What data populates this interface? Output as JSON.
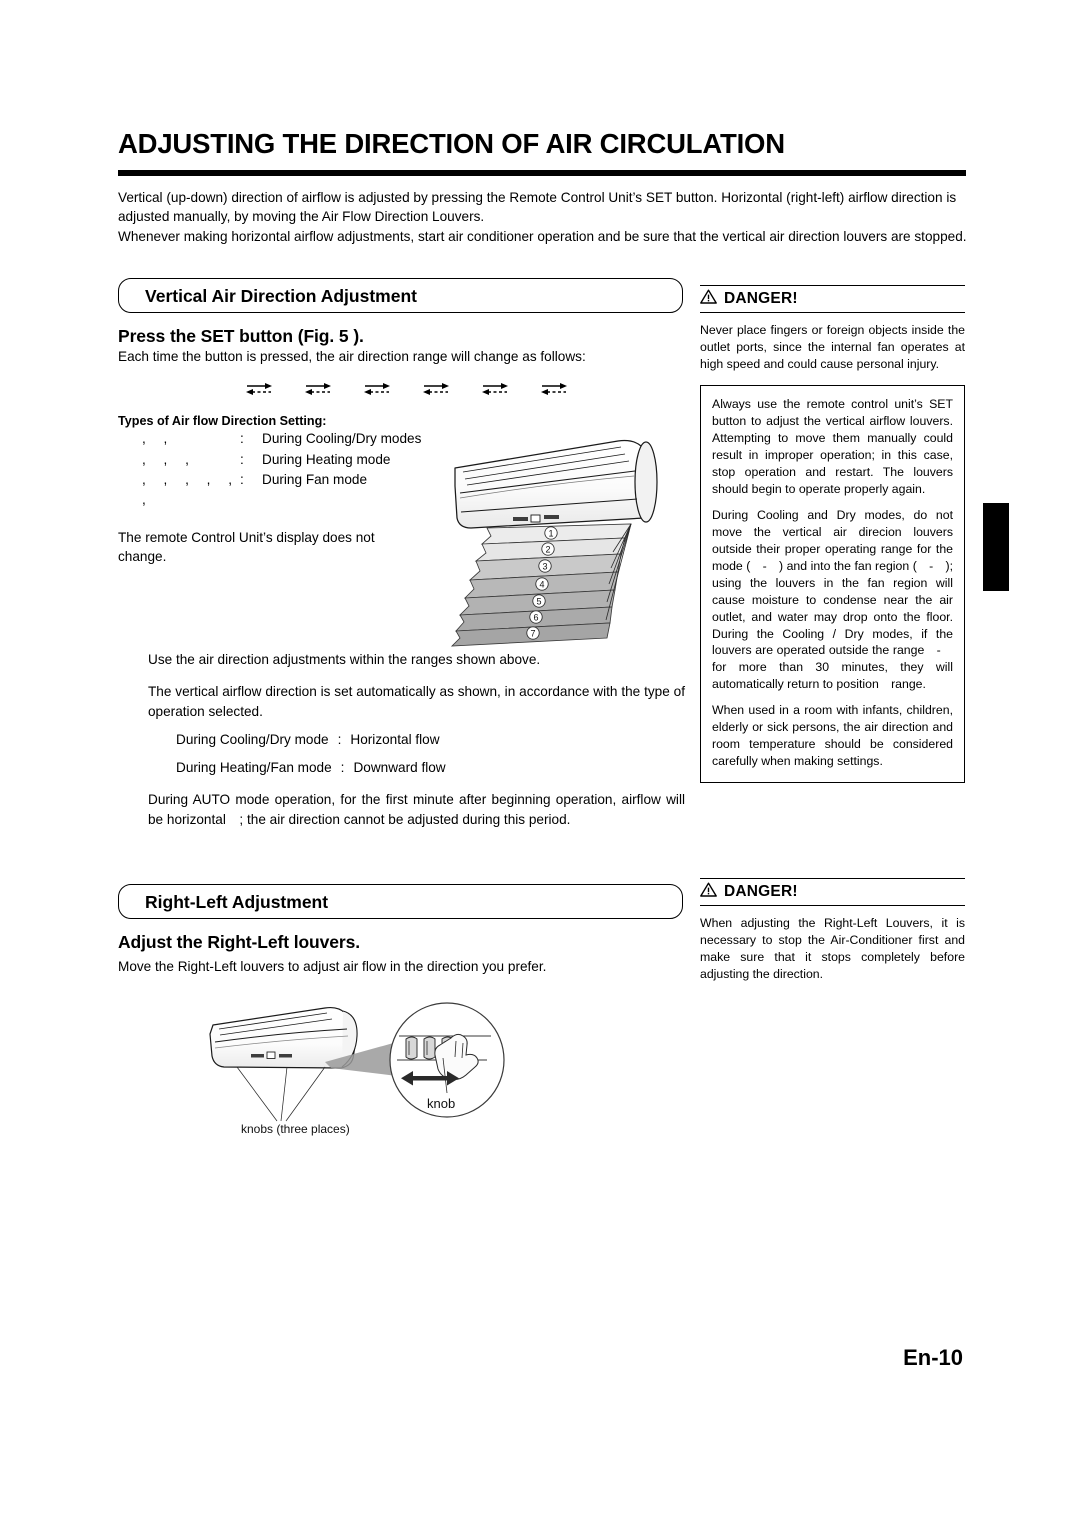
{
  "page": {
    "title": "ADJUSTING THE DIRECTION OF AIR CIRCULATION",
    "folio": "En-10"
  },
  "intro": {
    "line1": "Vertical (up-down) direction of airflow is adjusted by pressing the Remote Control Unit’s SET button. Horizontal (right-left) airflow direction is adjusted manually, by moving the Air Flow Direction Louvers.",
    "line2": "Whenever making horizontal airflow adjustments, start air conditioner operation and be sure that the vertical air direction louvers are stopped."
  },
  "vertical_section": {
    "header": "Vertical Air Direction Adjustment",
    "sub_head": "Press the SET button (Fig. 5    ).",
    "lead": "Each time the button is pressed, the air direction range will change as follows:",
    "arrow_count": 6,
    "arrow_icon": "airflow-direction-arrow",
    "types_head": "Types of Air flow Direction Setting:",
    "types_rows": [
      {
        "marks": ",  ,",
        "colon": ":",
        "mode": "During Cooling/Dry modes"
      },
      {
        "marks": ",  ,  ,",
        "colon": ":",
        "mode": "During Heating mode"
      },
      {
        "marks": ",  ,  ,  ,  ,  ,",
        "colon": ":",
        "mode": "During Fan mode"
      }
    ],
    "display_note": "The remote Control Unit’s display does not change.",
    "para_ranges": "Use the air direction adjustments within the ranges shown above.",
    "para_auto_set": "The vertical airflow direction is set automatically as shown, in accordance with the type of operation selected.",
    "mode_rows": [
      {
        "mode": "During Cooling/Dry mode",
        "colon": ":",
        "flow": "Horizontal flow"
      },
      {
        "mode": "During Heating/Fan mode",
        "colon": ":",
        "flow": "Downward flow"
      }
    ],
    "para_auto_mode": "During AUTO mode operation, for the first minute after beginning operation, airflow will be horizontal ; the air direction cannot be adjusted during this period.",
    "diagram": {
      "name": "vertical-airflow-range-diagram",
      "band_labels": [
        "①",
        "②",
        "③",
        "④",
        "⑤",
        "⑥",
        "⑦"
      ]
    }
  },
  "rightleft_section": {
    "header": "Right-Left Adjustment",
    "sub_head": "Adjust the Right-Left louvers.",
    "lead": "Move the Right-Left louvers to adjust air flow in the direction you prefer.",
    "diagram": {
      "name": "right-left-louver-knob-diagram",
      "caption_left": "knobs (three places)",
      "caption_detail": "knob"
    }
  },
  "danger_boxes": [
    {
      "label": "DANGER!",
      "icon": "warning-triangle-icon",
      "text": "Never place fingers or foreign objects inside the outlet ports, since the internal fan operates at high speed and could cause personal injury.",
      "note_paragraphs": [
        "Always use the remote control unit’s SET button to adjust the vertical airflow louvers. Attempting to move them manually could result in improper operation; in this case, stop operation and restart. The louvers should begin to operate properly again.",
        "During Cooling and Dry modes, do not move the vertical air direcion louvers outside their proper operating range for the mode (  -  ) and into the fan region (  -  ); using the louvers in the fan region will cause moisture to condense near the air outlet, and water may drop onto the floor. During the Cooling / Dry modes, if the louvers are operated outside the range  -  for more than 30 minutes, they will automatically return to position  range.",
        "When used in a room with infants, children, elderly or sick persons, the air direction and room temperature should be considered carefully when making settings."
      ]
    },
    {
      "label": "DANGER!",
      "icon": "warning-triangle-icon",
      "text": "When adjusting the Right-Left Louvers, it is necessary to stop the Air-Conditioner first and make sure that it stops completely before adjusting the direction.",
      "note_paragraphs": []
    }
  ]
}
